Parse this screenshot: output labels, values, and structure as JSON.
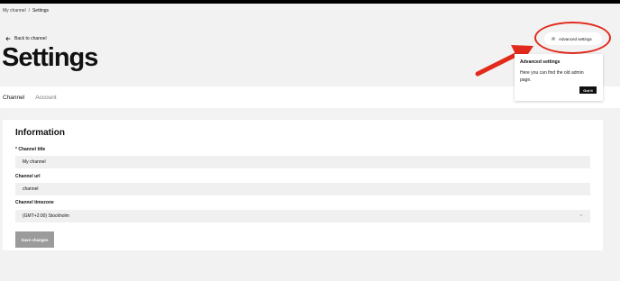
{
  "breadcrumb": {
    "parent": "My channel",
    "separator": "/",
    "current": "Settings"
  },
  "back_link": "Back to channel",
  "page_title": "Settings",
  "tabs": [
    {
      "label": "Channel",
      "active": true
    },
    {
      "label": "Account",
      "active": false
    }
  ],
  "info": {
    "heading": "Information",
    "channel_title_label": "* Channel title",
    "channel_title_value": "My channel",
    "channel_url_label": "Channel url",
    "channel_url_value": "channel",
    "timezone_label": "Channel timezone",
    "timezone_value": "(GMT+2:00) Stockholm",
    "save_label": "Save changes"
  },
  "advanced": {
    "button_label": "Advanced settings"
  },
  "popover": {
    "heading": "Advanced settings",
    "text": "Here you can find the old admin page.",
    "button": "Got it"
  },
  "colors": {
    "annotation": "#e12a1c",
    "accent": "#111111",
    "button_disabled": "#9b9b9b"
  },
  "icons": {
    "back": "arrow-left-icon",
    "advanced": "gear-icon",
    "dropdown": "chevron-down-icon"
  }
}
